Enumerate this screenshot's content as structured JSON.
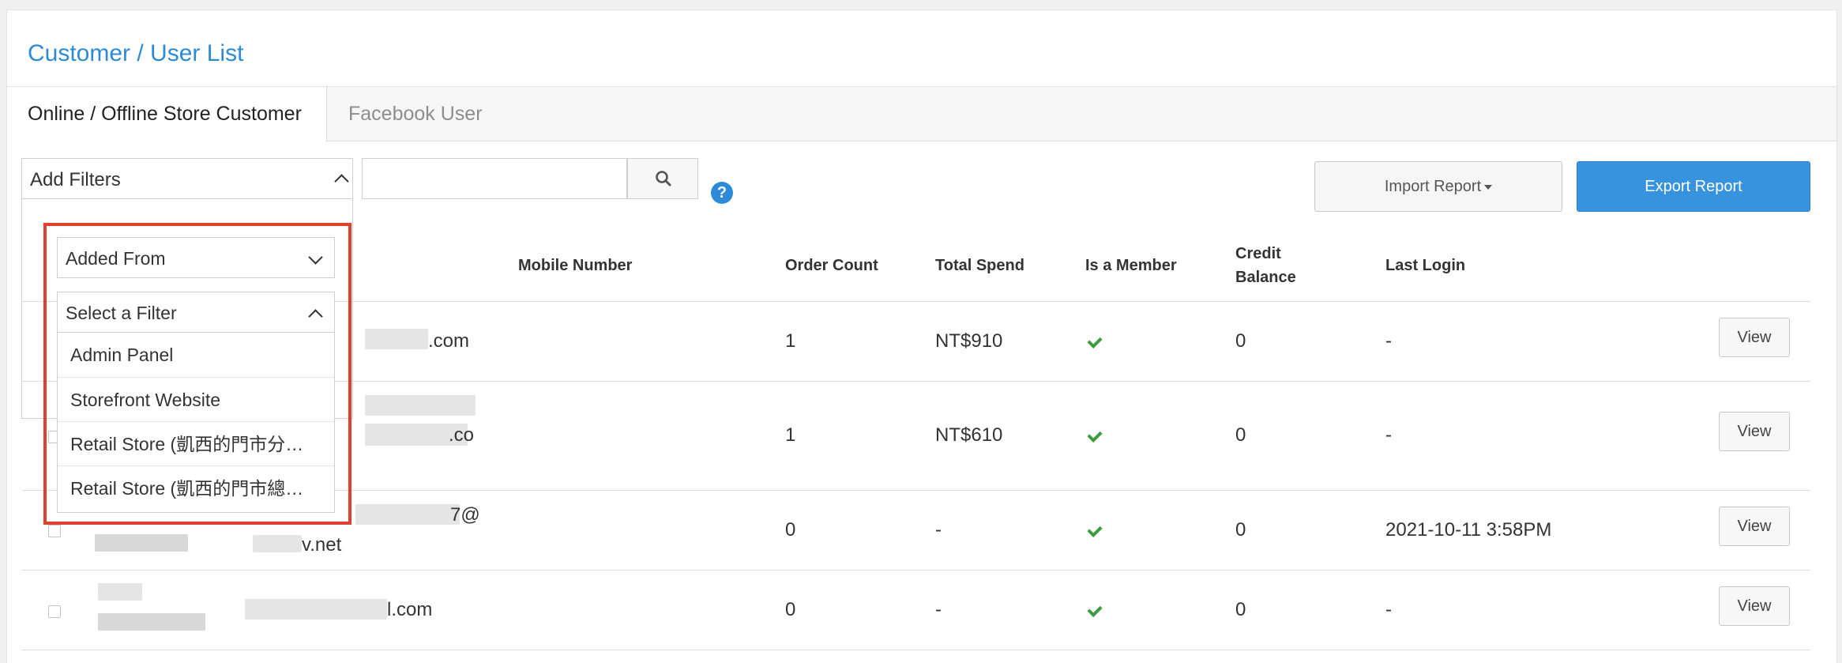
{
  "header": {
    "title": "Customer / User List"
  },
  "tabs": [
    {
      "label": "Online / Offline Store Customer",
      "active": true
    },
    {
      "label": "Facebook User",
      "active": false
    }
  ],
  "toolbar": {
    "add_filters_label": "Add Filters",
    "search_placeholder": "",
    "help_icon": "?",
    "import_label": "Import Report",
    "export_label": "Export Report"
  },
  "filters": {
    "added_from_label": "Added From",
    "select_filter_label": "Select a Filter",
    "options": [
      "Admin Panel",
      "Storefront Website",
      "Retail Store (凱西的門市分…",
      "Retail Store (凱西的門市總…"
    ]
  },
  "table": {
    "columns": {
      "mobile": "Mobile Number",
      "orders": "Order Count",
      "spend": "Total Spend",
      "member": "Is a Member",
      "credit": "Credit Balance",
      "login": "Last Login"
    },
    "rows": [
      {
        "email_fragment": ".com",
        "email_line2": "",
        "orders": "1",
        "spend": "NT$910",
        "member": true,
        "credit": "0",
        "login": "-",
        "action": "View"
      },
      {
        "email_fragment": ".co",
        "email_line2": "",
        "orders": "1",
        "spend": "NT$610",
        "member": true,
        "credit": "0",
        "login": "-",
        "action": "View"
      },
      {
        "email_fragment": "7@",
        "email_line2": "v.net",
        "orders": "0",
        "spend": "-",
        "member": true,
        "credit": "0",
        "login": "2021-10-11 3:58PM",
        "action": "View"
      },
      {
        "email_fragment": "l.com",
        "email_line2": "",
        "orders": "0",
        "spend": "-",
        "member": true,
        "credit": "0",
        "login": "-",
        "action": "View"
      }
    ]
  },
  "colors": {
    "accent": "#2d8ad6",
    "primary_button": "#3793dd",
    "check": "#3f9b3f",
    "highlight_frame": "#e0402e"
  }
}
